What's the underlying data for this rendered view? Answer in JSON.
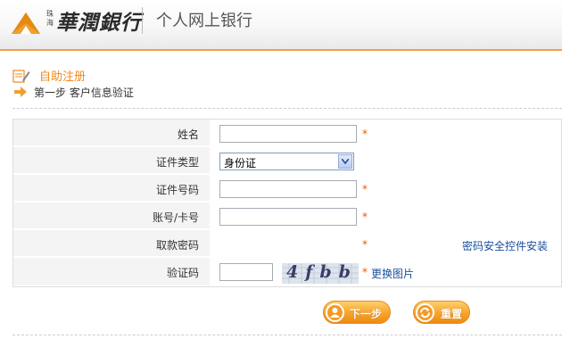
{
  "header": {
    "brand_small": "珠海",
    "brand_name": "華潤銀行",
    "title": "个人网上银行"
  },
  "section": {
    "title": "自助注册",
    "step": "第一步 客户信息验证"
  },
  "form": {
    "name_label": "姓名",
    "name_value": "",
    "id_type_label": "证件类型",
    "id_type_value": "身份证",
    "id_number_label": "证件号码",
    "id_number_value": "",
    "account_label": "账号/卡号",
    "account_value": "",
    "pin_label": "取款密码",
    "pin_link": "密码安全控件安装",
    "captcha_label": "验证码",
    "captcha_value": "",
    "captcha_text": "4fbb",
    "captcha_refresh": "更换图片",
    "required_mark": "*"
  },
  "buttons": {
    "next": "下一步",
    "reset": "重置"
  },
  "icons": {
    "logo": "logo-icon",
    "register": "register-icon",
    "step": "arrow-right-icon",
    "dropdown": "chevron-down-icon",
    "next": "user-icon",
    "reset": "refresh-icon"
  },
  "colors": {
    "accent": "#f08a1c",
    "required": "#e65a00",
    "link": "#1a4f9a",
    "button": "#f6a32c"
  }
}
